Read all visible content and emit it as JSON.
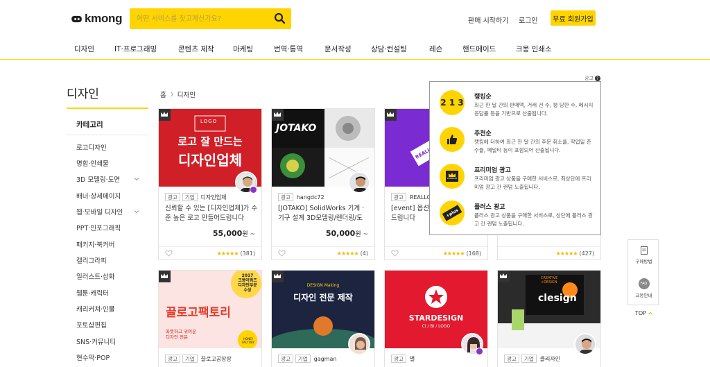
{
  "header": {
    "logo_text": "kmong",
    "search_placeholder": "어떤 서비스를 찾고계신가요?",
    "start_selling": "판매 시작하기",
    "login": "로그인",
    "join": "무료 회원가입"
  },
  "nav": [
    "디자인",
    "IT·프로그래밍",
    "콘텐츠 제작",
    "마케팅",
    "번역·통역",
    "문서작성",
    "상담·컨설팅",
    "레슨",
    "핸드메이드",
    "크몽 인쇄소"
  ],
  "sidebar": {
    "title": "디자인",
    "category_label": "카테고리",
    "items": [
      "로고디자인",
      "명함·인쇄물",
      "3D 모델링·도면",
      "배너·상세페이지",
      "웹·모바일 디자인",
      "PPT·인포그래픽",
      "패키지·북커버",
      "캘리그라피",
      "일러스트·삽화",
      "웹툰·캐릭터",
      "캐리커쳐·인물",
      "포토샵편집",
      "SNS·커뮤니티",
      "현수막·POP"
    ]
  },
  "breadcrumb": {
    "home": "홈",
    "current": "디자인"
  },
  "ad_label": "광고",
  "cards": [
    {
      "tag1": "광고",
      "tag2": "기업",
      "seller": "디자인업체",
      "title": "신뢰할 수 있는 [디자인업체]가 수준 높은 로고 만들어드립니다",
      "price": "55,000",
      "unit": "원 ~",
      "reviews": "(381)",
      "thumb_line1": "로고 잘 만드는",
      "thumb_line2": "디자인업체",
      "thumb_small": "LOGO"
    },
    {
      "tag1": "광고",
      "tag2": "",
      "seller": "hangdc72",
      "title": "[JOTAKO] SolidWorks 기계 · 기구 설계 3D모델링/렌더링/도면...",
      "price": "50,000",
      "unit": "원 ~",
      "reviews": "(4)",
      "thumb_line1": "JOTAKO"
    },
    {
      "tag1": "광고",
      "tag2": "",
      "seller": "REALLOGO",
      "title": "[event] 옵션없이 LOGO 만들어드립니다",
      "price": "",
      "unit": "",
      "reviews": "(168)",
      "thumb_line1": "REALLOGO"
    },
    {
      "tag1": "",
      "tag2": "",
      "seller": "",
      "title": "",
      "price": "",
      "unit": "",
      "reviews": "(427)"
    },
    {
      "tag1": "광고",
      "tag2": "기업",
      "seller": "끌로고공장장",
      "title": "",
      "price": "",
      "unit": "",
      "reviews": "",
      "thumb_line1": "끌로고팩토리",
      "thumb_badge1": "2017",
      "thumb_badge2": "크몽어워즈",
      "thumb_badge3": "디자인부문",
      "thumb_badge4": "수상",
      "thumb_sub1": "따뜻하고 귀여운",
      "thumb_sub2": "디자인 전문",
      "thumb_honey": "HONEY FACTORY"
    },
    {
      "tag1": "광고",
      "tag2": "기업",
      "seller": "gagman",
      "title": "",
      "price": "",
      "unit": "",
      "reviews": "",
      "thumb_small": "DESIGN Making",
      "thumb_line1": "디자인 전문 제작"
    },
    {
      "tag1": "광고",
      "tag2": "",
      "seller": "별",
      "title": "",
      "price": "",
      "unit": "",
      "reviews": "",
      "thumb_line1": "STARDESIGN",
      "thumb_small": "CI / BI / LOGO"
    },
    {
      "tag1": "광고",
      "tag2": "기업",
      "seller": "클리자인",
      "title": "",
      "price": "",
      "unit": "",
      "reviews": "",
      "thumb_line1": "clesign",
      "thumb_small1": "CREATIVE",
      "thumb_small2": "+DESIGN"
    }
  ],
  "tooltip": [
    {
      "title": "랭킹순",
      "desc": "최근 한 달 간의 판매액, 거래 건 수, 평 당한 수, 메시지 응답률 등을 기반으로 산출됩니다.",
      "icon": "ranking-icon",
      "icon_text": "2 1 3"
    },
    {
      "title": "추천순",
      "desc": "랭킹에 더하여 최근 한 달 간의 주문 취소율, 작업일 준수율, 페널티 등이 포함되어 산출됩니다.",
      "icon": "thumbs-up-icon"
    },
    {
      "title": "프리미엄 광고",
      "desc": "프리미엄 광고 상품을 구매한 서비스로, 최상단에 프리미엄 광고 간 랜덤 노출됩니다.",
      "icon": "premium-icon",
      "icon_text": "PREMIUM"
    },
    {
      "title": "플러스 광고",
      "desc": "플러스 광고 상품을 구매한 서비스로, 상단에 플러스 광고 간 랜덤 노출됩니다.",
      "icon": "plus-icon",
      "icon_text": "+plus"
    }
  ],
  "floating": {
    "buy_guide": "구매방법",
    "faq": "크몽안내",
    "faq_icon_text": "FAQ",
    "top": "TOP"
  },
  "colors": {
    "brand": "#ffd400",
    "premium_badge": "#333333",
    "star": "#f5b700"
  }
}
